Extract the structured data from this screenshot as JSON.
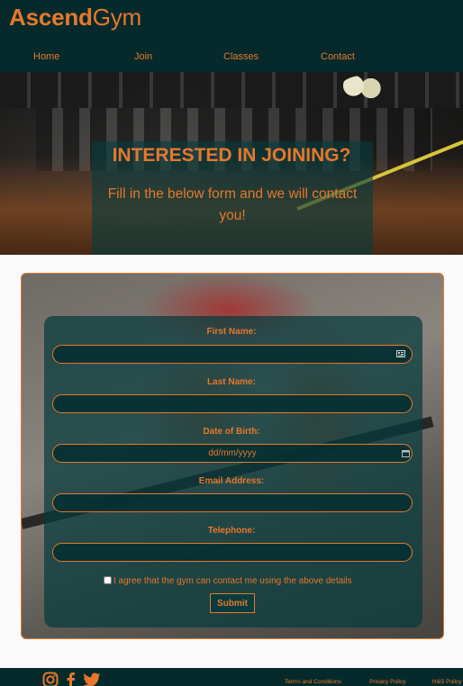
{
  "brand": {
    "name_bold": "Ascend",
    "name_light": "Gym",
    "color": "#e5782d",
    "header_bg": "#062a2b"
  },
  "nav": {
    "items": [
      "Home",
      "Join",
      "Classes",
      "Contact"
    ]
  },
  "hero": {
    "title": "INTERESTED IN JOINING?",
    "subtitle": "Fill in the below form and we will contact you!"
  },
  "form": {
    "first_name_label": "First Name:",
    "last_name_label": "Last Name:",
    "dob_label": "Date of Birth:",
    "dob_placeholder": "dd/mm/yyyy",
    "email_label": "Email Address:",
    "telephone_label": "Telephone:",
    "consent_text": "I agree that the gym can contact me using the above details",
    "submit_label": "Submit",
    "icons": {
      "autofill": "contact-card-icon",
      "calendar": "calendar-icon"
    }
  },
  "footer": {
    "social_icons": [
      "instagram-icon",
      "facebook-icon",
      "twitter-icon"
    ],
    "links": [
      "Terms and Conditions",
      "Privacy Policy",
      "H&S Policy"
    ]
  }
}
